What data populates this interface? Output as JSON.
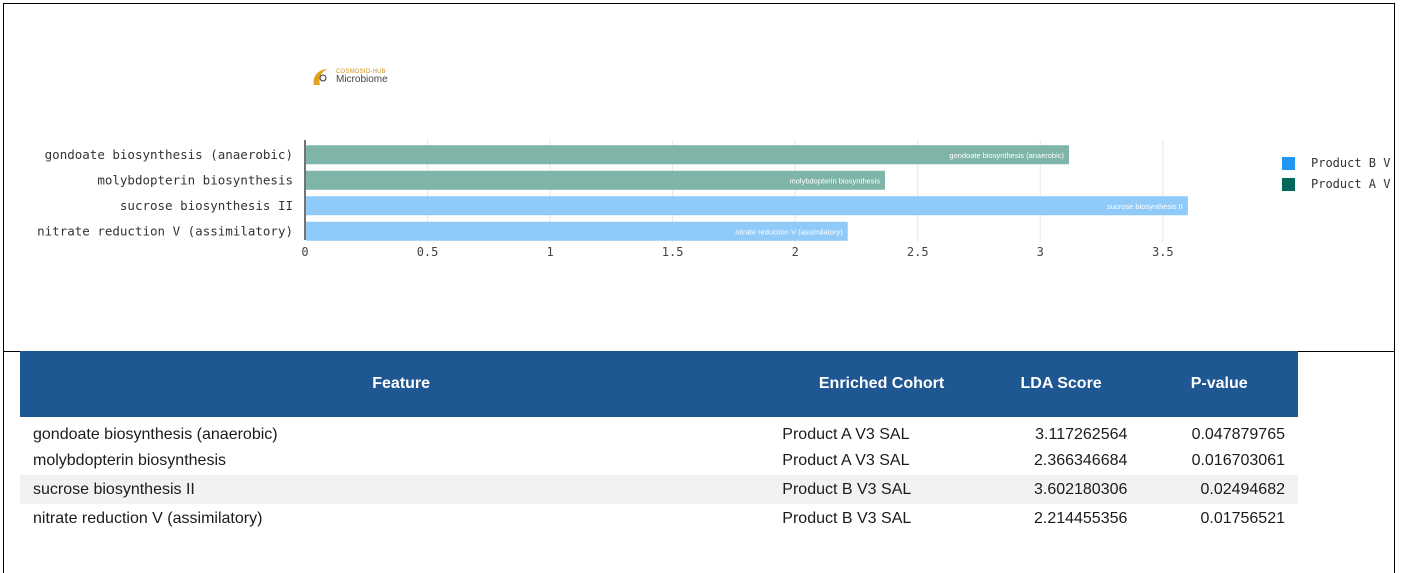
{
  "logo": {
    "top_text": "COSMOSID-HUB",
    "bottom_text": "Microbiome"
  },
  "chart_data": {
    "type": "bar",
    "orientation": "horizontal",
    "categories": [
      "gondoate biosynthesis (anaerobic)",
      "molybdopterin biosynthesis",
      "sucrose biosynthesis II",
      "nitrate reduction V (assimilatory)"
    ],
    "values": [
      3.117262564,
      2.366346684,
      3.602180306,
      2.214455356
    ],
    "bar_labels": [
      "gondoate biosynthesis (anaerobic)",
      "molybdopterin biosynthesis",
      "sucrose biosynthesis II",
      "nitrate reduction V (assimilatory)"
    ],
    "bar_series": [
      "Product A V3 SAL",
      "Product A V3 SAL",
      "Product B V3 SAL",
      "Product B V3 SAL"
    ],
    "x_ticks": [
      "0",
      "0.5",
      "1",
      "1.5",
      "2",
      "2.5",
      "3",
      "3.5"
    ],
    "xlim": [
      0,
      3.77
    ],
    "grid": true,
    "legend_placement": "right",
    "series": [
      {
        "name": "Product B V3 SAL",
        "legend_label": "Product B V",
        "color": "#2196f3",
        "bar_color": "#90caf9"
      },
      {
        "name": "Product A V3 SAL",
        "legend_label": "Product A V",
        "color": "#00695c",
        "bar_color": "#7fb4a9"
      }
    ]
  },
  "table": {
    "headers": [
      "Feature",
      "Enriched Cohort",
      "LDA Score",
      "P-value"
    ],
    "rows": [
      [
        "gondoate biosynthesis (anaerobic)",
        "Product A V3 SAL",
        "3.117262564",
        "0.047879765"
      ],
      [
        "molybdopterin biosynthesis",
        "Product A V3 SAL",
        "2.366346684",
        "0.016703061"
      ],
      [
        "sucrose biosynthesis II",
        "Product B V3 SAL",
        "3.602180306",
        "0.02494682"
      ],
      [
        "nitrate reduction V (assimilatory)",
        "Product B V3 SAL",
        "2.214455356",
        "0.01756521"
      ]
    ],
    "header_color": "#1f5793"
  }
}
